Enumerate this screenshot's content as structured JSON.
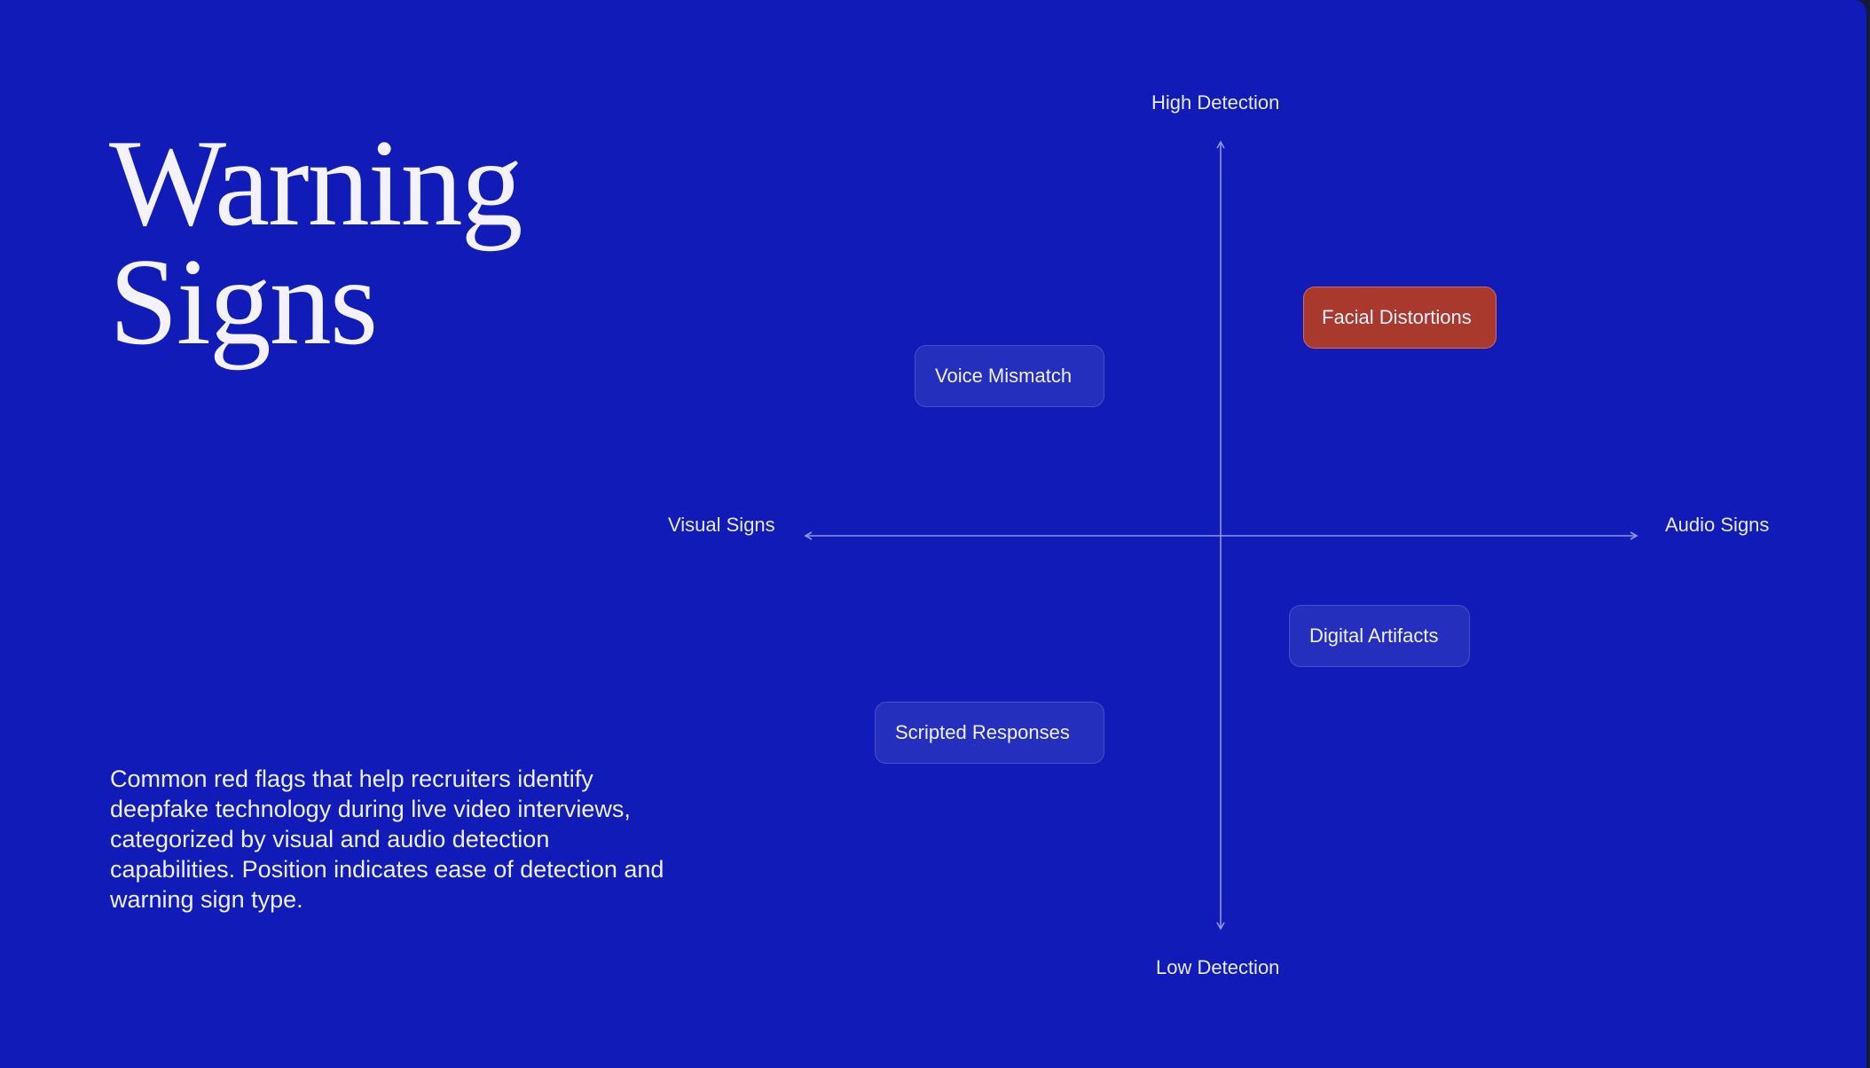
{
  "title": {
    "line1": "Warning",
    "line2": "Signs"
  },
  "description": "Common red flags that help recruiters identify deepfake technology during live video interviews, categorized by visual and audio detection capabilities. Position indicates ease of detection and warning sign type.",
  "axes": {
    "top": "High Detection",
    "bottom": "Low Detection",
    "left": "Visual Signs",
    "right": "Audio Signs"
  },
  "items": [
    {
      "label": "Voice Mismatch",
      "highlighted": false
    },
    {
      "label": "Facial Distortions",
      "highlighted": true
    },
    {
      "label": "Digital Artifacts",
      "highlighted": false
    },
    {
      "label": "Scripted Responses",
      "highlighted": false
    }
  ],
  "colors": {
    "background": "#101bb8",
    "highlight": "#a8392c",
    "text": "#ffffff"
  }
}
